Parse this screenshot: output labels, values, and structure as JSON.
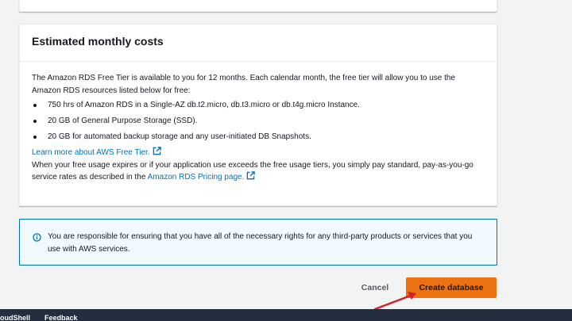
{
  "cost_section": {
    "title": "Estimated monthly costs",
    "intro": "The Amazon RDS Free Tier is available to you for 12 months. Each calendar month, the free tier will allow you to use the Amazon RDS resources listed below for free:",
    "bullets": [
      "750 hrs of Amazon RDS in a Single-AZ db.t2.micro, db.t3.micro or db.t4g.micro Instance.",
      "20 GB of General Purpose Storage (SSD).",
      "20 GB for automated backup storage and any user-initiated DB Snapshots."
    ],
    "free_tier_link": "Learn more about AWS Free Tier.",
    "expiry_text": "When your free usage expires or if your application use exceeds the free usage tiers, you simply pay standard, pay-as-you-go service rates as described in the",
    "pricing_link": "Amazon RDS Pricing page."
  },
  "info_alert": {
    "icon": "info-icon",
    "text": "You are responsible for ensuring that you have all of the necessary rights for any third-party products or services that you use with AWS services."
  },
  "actions": {
    "cancel_label": "Cancel",
    "create_label": "Create database"
  },
  "footer": {
    "cloudshell_label": "oudShell",
    "feedback_label": "Feedback"
  },
  "colors": {
    "primary_button": "#ec7211",
    "link": "#0073bb",
    "annotation_arrow": "#d81e28",
    "footer_bg": "#232f3e"
  }
}
